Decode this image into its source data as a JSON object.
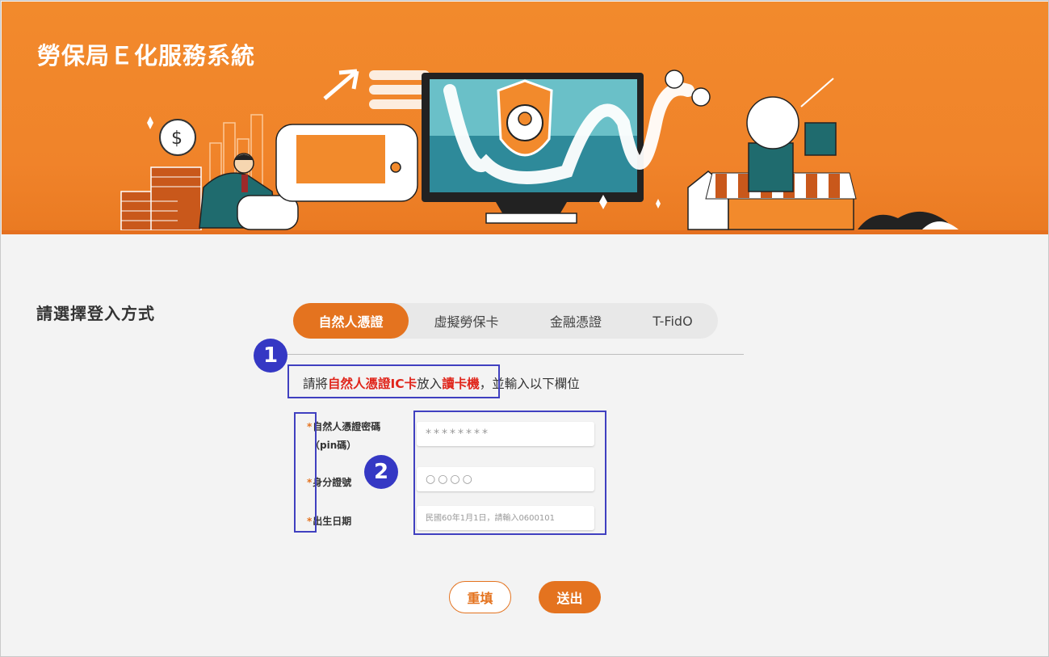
{
  "header": {
    "title": "勞保局Ｅ化服務系統"
  },
  "login": {
    "choose_label": "請選擇登入方式",
    "tabs": [
      {
        "label": "自然人憑證",
        "active": true
      },
      {
        "label": "虛擬勞保卡",
        "active": false
      },
      {
        "label": "金融憑證",
        "active": false
      },
      {
        "label": "T-FidO",
        "active": false
      }
    ],
    "instruction": {
      "prefix": "請將",
      "card": "自然人憑證IC卡",
      "middle": "放入",
      "reader": "讀卡機",
      "suffix": "，並輸入以下欄位"
    },
    "fields": {
      "pin_label_line1": "自然人憑證密碼",
      "pin_label_line2": "（pin碼）",
      "pin_value": "********",
      "id_label": "身分證號",
      "id_value": "○○○○",
      "dob_label": "出生日期",
      "dob_placeholder": "民國60年1月1日，請輸入0600101",
      "required_mark": "*"
    },
    "buttons": {
      "reset": "重填",
      "submit": "送出"
    }
  },
  "annotations": {
    "badge1": "1",
    "badge2": "2"
  },
  "colors": {
    "brand_orange": "#e4731f",
    "banner_orange": "#f28a2c",
    "highlight_red": "#e0261c",
    "annotation_blue": "#3538c4"
  }
}
